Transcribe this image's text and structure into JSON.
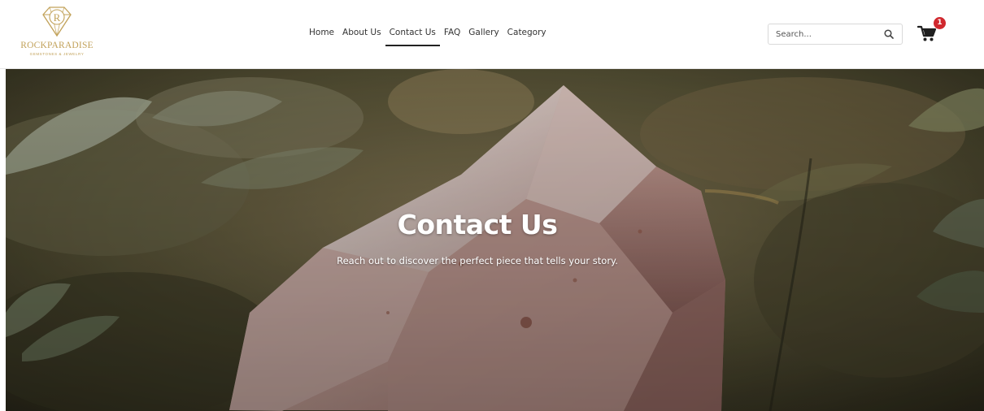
{
  "brand": {
    "name": "ROCKPARADISE",
    "tagline": "GEMSTONES & JEWELRY",
    "monogram": "R",
    "gold_color": "#c2a25a"
  },
  "nav": {
    "items": [
      {
        "label": "Home",
        "active": false
      },
      {
        "label": "About Us",
        "active": false
      },
      {
        "label": "Contact Us",
        "active": true
      },
      {
        "label": "FAQ",
        "active": false
      },
      {
        "label": "Gallery",
        "active": false
      },
      {
        "label": "Category",
        "active": false
      }
    ]
  },
  "search": {
    "placeholder": "Search...",
    "icon": "search-icon"
  },
  "cart": {
    "icon": "shopping-cart-icon",
    "count": "1",
    "badge_color": "#d0282e"
  },
  "hero": {
    "title": "Contact Us",
    "subtitle": "Reach out to discover the perfect piece that tells your story.",
    "image": "rose-quartz-crystal-among-leaves"
  }
}
